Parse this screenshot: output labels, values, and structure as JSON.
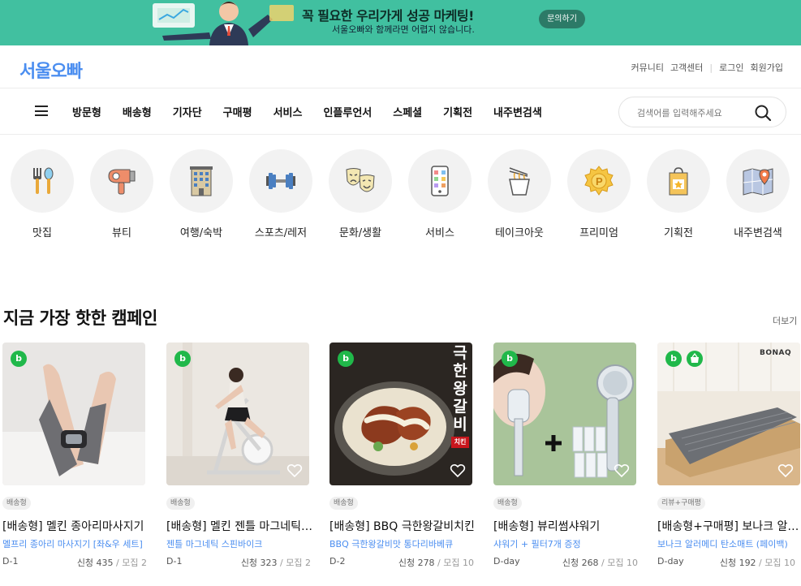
{
  "banner": {
    "headline": "꼭 필요한 우리가게 성공 마케팅!",
    "sub": "서울오빠와 함께라면 어렵지 않습니다.",
    "cta": "문의하기"
  },
  "header": {
    "logo": "서울오빠",
    "links": [
      "커뮤니티",
      "고객센터",
      "로그인",
      "회원가입"
    ]
  },
  "menu": {
    "items": [
      "방문형",
      "배송형",
      "기자단",
      "구매평",
      "서비스",
      "인플루언서",
      "스페셜",
      "기획전",
      "내주변검색"
    ],
    "search_placeholder": "검색어를 입력해주세요"
  },
  "categories": [
    {
      "label": "맛집",
      "icon": "cutlery-icon"
    },
    {
      "label": "뷰티",
      "icon": "hairdryer-icon"
    },
    {
      "label": "여행/숙박",
      "icon": "hotel-icon"
    },
    {
      "label": "스포츠/레저",
      "icon": "dumbbell-icon"
    },
    {
      "label": "문화/생활",
      "icon": "theater-masks-icon"
    },
    {
      "label": "서비스",
      "icon": "smartphone-icon"
    },
    {
      "label": "테이크아웃",
      "icon": "noodle-cup-icon"
    },
    {
      "label": "프리미엄",
      "icon": "premium-badge-icon"
    },
    {
      "label": "기획전",
      "icon": "shopping-bag-icon"
    },
    {
      "label": "내주변검색",
      "icon": "map-pin-icon"
    }
  ],
  "section": {
    "title": "지금 가장 핫한 캠페인",
    "more": "더보기"
  },
  "cards": [
    {
      "tag": "배송형",
      "title": "[배송형] 멜킨 종아리마사지기",
      "desc": "멜프리 종아리 마사지기 [좌&우 세트]",
      "dday": "D-1",
      "apply": "신청 435",
      "recruit": "모집 2",
      "image": "leg-massager-photo",
      "basket": false
    },
    {
      "tag": "배송형",
      "title": "[배송형] 멜킨 젠틀 마그네틱 스핀바이크",
      "desc": "젠틀 마그네틱 스핀바이크",
      "dday": "D-1",
      "apply": "신청 323",
      "recruit": "모집 2",
      "image": "spin-bike-photo",
      "basket": false
    },
    {
      "tag": "배송형",
      "title": "[배송형] BBQ 극한왕갈비치킨",
      "desc": "BBQ 극한왕갈비맛 통다리바베큐",
      "dday": "D-2",
      "apply": "신청 278",
      "recruit": "모집 10",
      "image": "chicken-photo",
      "basket": false,
      "overlay": "극한왕갈비",
      "overlay_tag": "치킨"
    },
    {
      "tag": "배송형",
      "title": "[배송형] 뷰리썸샤워기",
      "desc": "샤워기 + 필터7개 증정",
      "dday": "D-day",
      "apply": "신청 268",
      "recruit": "모집 10",
      "image": "shower-head-photo",
      "basket": false
    },
    {
      "tag": "리뷰+구매평",
      "title": "[배송형+구매평] 보나크 알러메디 탄소매트",
      "desc": "보나크 알러메디 탄소매트 (페이백)",
      "dday": "D-day",
      "apply": "신청 192",
      "recruit": "모집 10",
      "image": "carbon-mat-photo",
      "basket": true,
      "brand": "BONAQ"
    }
  ],
  "colors": {
    "brand": "#4b8ef0",
    "banner": "#41c0a0",
    "badge": "#20b84a"
  }
}
